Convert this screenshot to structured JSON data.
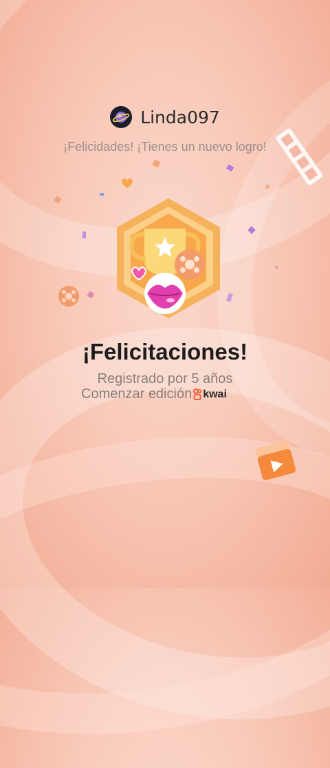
{
  "user": {
    "name": "Linda097",
    "avatar_icon": "planet-icon"
  },
  "subtitle": "¡Felicidades! ¡Tienes un nuevo logro!",
  "badge": {
    "icon": "trophy-badge-icon"
  },
  "headline": "¡Felicitaciones!",
  "detail_line1": "Registrado por 5 años",
  "detail_line2": "Comenzar edición",
  "brand": {
    "name": "kwai",
    "icon": "kwai-logo-icon"
  },
  "colors": {
    "accent_orange": "#f7a94a",
    "lips_pink": "#e23fae",
    "background": "#f9cbbb"
  }
}
